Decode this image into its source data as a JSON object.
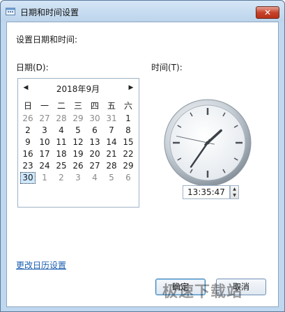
{
  "window": {
    "title": "日期和时间设置",
    "close_glyph": "✕"
  },
  "intro_label": "设置日期和时间:",
  "date_section": {
    "label": "日期(D):",
    "prev_glyph": "◀",
    "next_glyph": "▶",
    "month_title": "2018年9月",
    "weekdays": [
      "日",
      "一",
      "二",
      "三",
      "四",
      "五",
      "六"
    ],
    "weeks": [
      [
        {
          "d": "26",
          "other": true
        },
        {
          "d": "27",
          "other": true
        },
        {
          "d": "28",
          "other": true
        },
        {
          "d": "29",
          "other": true
        },
        {
          "d": "30",
          "other": true
        },
        {
          "d": "31",
          "other": true
        },
        {
          "d": "1"
        }
      ],
      [
        {
          "d": "2"
        },
        {
          "d": "3"
        },
        {
          "d": "4"
        },
        {
          "d": "5"
        },
        {
          "d": "6"
        },
        {
          "d": "7"
        },
        {
          "d": "8"
        }
      ],
      [
        {
          "d": "9"
        },
        {
          "d": "10"
        },
        {
          "d": "11"
        },
        {
          "d": "12"
        },
        {
          "d": "13"
        },
        {
          "d": "14"
        },
        {
          "d": "15"
        }
      ],
      [
        {
          "d": "16"
        },
        {
          "d": "17"
        },
        {
          "d": "18"
        },
        {
          "d": "19"
        },
        {
          "d": "20"
        },
        {
          "d": "21"
        },
        {
          "d": "22"
        }
      ],
      [
        {
          "d": "23"
        },
        {
          "d": "24"
        },
        {
          "d": "25"
        },
        {
          "d": "26"
        },
        {
          "d": "27"
        },
        {
          "d": "28"
        },
        {
          "d": "29"
        }
      ],
      [
        {
          "d": "30",
          "selected": true
        },
        {
          "d": "1",
          "other": true
        },
        {
          "d": "2",
          "other": true
        },
        {
          "d": "3",
          "other": true
        },
        {
          "d": "4",
          "other": true
        },
        {
          "d": "5",
          "other": true
        },
        {
          "d": "6",
          "other": true
        }
      ]
    ]
  },
  "time_section": {
    "label": "时间(T):",
    "time_value": "13:35:47",
    "hour": 13,
    "minute": 35,
    "second": 47,
    "spin_up_glyph": "▲",
    "spin_down_glyph": "▼"
  },
  "calendar_link": "更改日历设置",
  "buttons": {
    "ok": "确定",
    "cancel": "取消"
  },
  "watermark": "极速下载站",
  "colors": {
    "accent": "#1c5fb0",
    "selected_day": "#cde8ff",
    "close_button": "#c7432b"
  }
}
